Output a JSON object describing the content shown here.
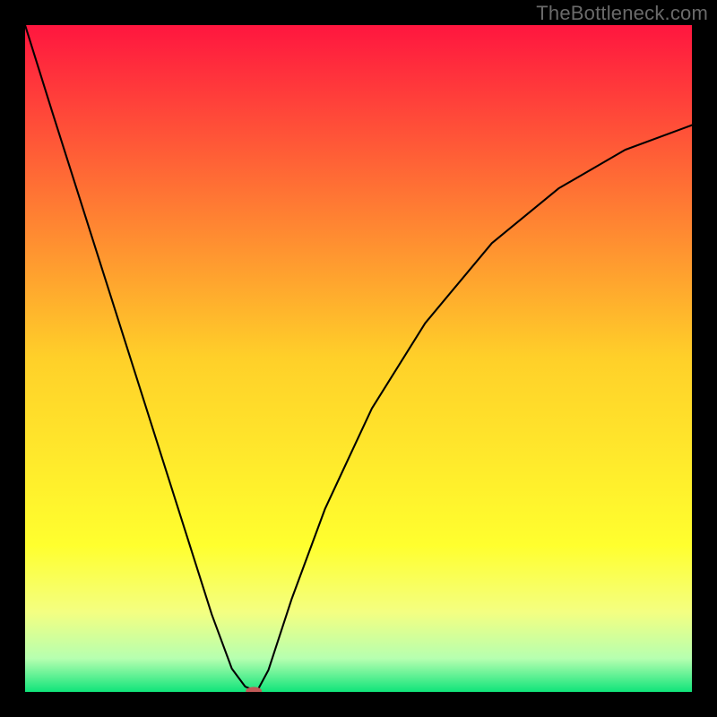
{
  "watermark": "TheBottleneck.com",
  "chart_data": {
    "type": "line",
    "title": "",
    "xlabel": "",
    "ylabel": "",
    "xlim": [
      0,
      100
    ],
    "ylim": [
      0,
      100
    ],
    "grid": false,
    "legend": false,
    "background_gradient": {
      "stops": [
        {
          "offset": 0.0,
          "color": "#ff163f"
        },
        {
          "offset": 0.5,
          "color": "#ffd029"
        },
        {
          "offset": 0.78,
          "color": "#ffff2e"
        },
        {
          "offset": 0.88,
          "color": "#f4ff81"
        },
        {
          "offset": 0.95,
          "color": "#b6ffb0"
        },
        {
          "offset": 1.0,
          "color": "#10e47a"
        }
      ]
    },
    "series": [
      {
        "name": "bottleneck-curve",
        "x": [
          0,
          4,
          8,
          12,
          16,
          20,
          24,
          28,
          31,
          33,
          34.5,
          35,
          36.5,
          40,
          45,
          52,
          60,
          70,
          80,
          90,
          100
        ],
        "y": [
          100,
          87.2,
          74.6,
          62.0,
          49.4,
          36.8,
          24.2,
          11.6,
          3.5,
          0.8,
          0.15,
          0.5,
          3.3,
          14.0,
          27.5,
          42.5,
          55.3,
          67.3,
          75.5,
          81.3,
          85.0
        ]
      }
    ],
    "marker": {
      "name": "optimal-point",
      "x": 34.3,
      "y": 0.15,
      "color": "#c15a57",
      "rx": 1.2,
      "ry": 0.6
    }
  }
}
